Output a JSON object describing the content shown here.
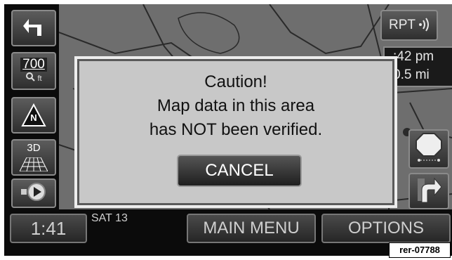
{
  "map": {
    "scale_value": "700",
    "scale_unit": "ft",
    "north_label": "N",
    "view_label": "3D",
    "repeat_label": "RPT",
    "arrival_time": ":42 pm",
    "distance": "0.5 mi"
  },
  "dialog": {
    "title": "Caution!",
    "line1": "Map data in this area",
    "line2": "has NOT been verified.",
    "cancel_label": "CANCEL"
  },
  "bottom_bar": {
    "time": "1:41",
    "date": "SAT 13",
    "main_menu_label": "MAIN MENU",
    "options_label": "OPTIONS"
  },
  "reference_code": "rer-07788",
  "icons": {
    "back": "back-arrow-icon",
    "zoom": "magnifier-icon",
    "north": "north-up-icon",
    "perspective": "3d-grid-icon",
    "route_guidance": "speaker-play-icon",
    "stop": "stop-sign-icon",
    "turn": "turn-right-icon",
    "repeat_sound": "sound-waves-icon"
  },
  "colors": {
    "screen_background": "#0b0b0b",
    "map_background": "#6e6e6e",
    "dialog_background": "#c8c8c8",
    "button_text": "#cfcfcf"
  }
}
